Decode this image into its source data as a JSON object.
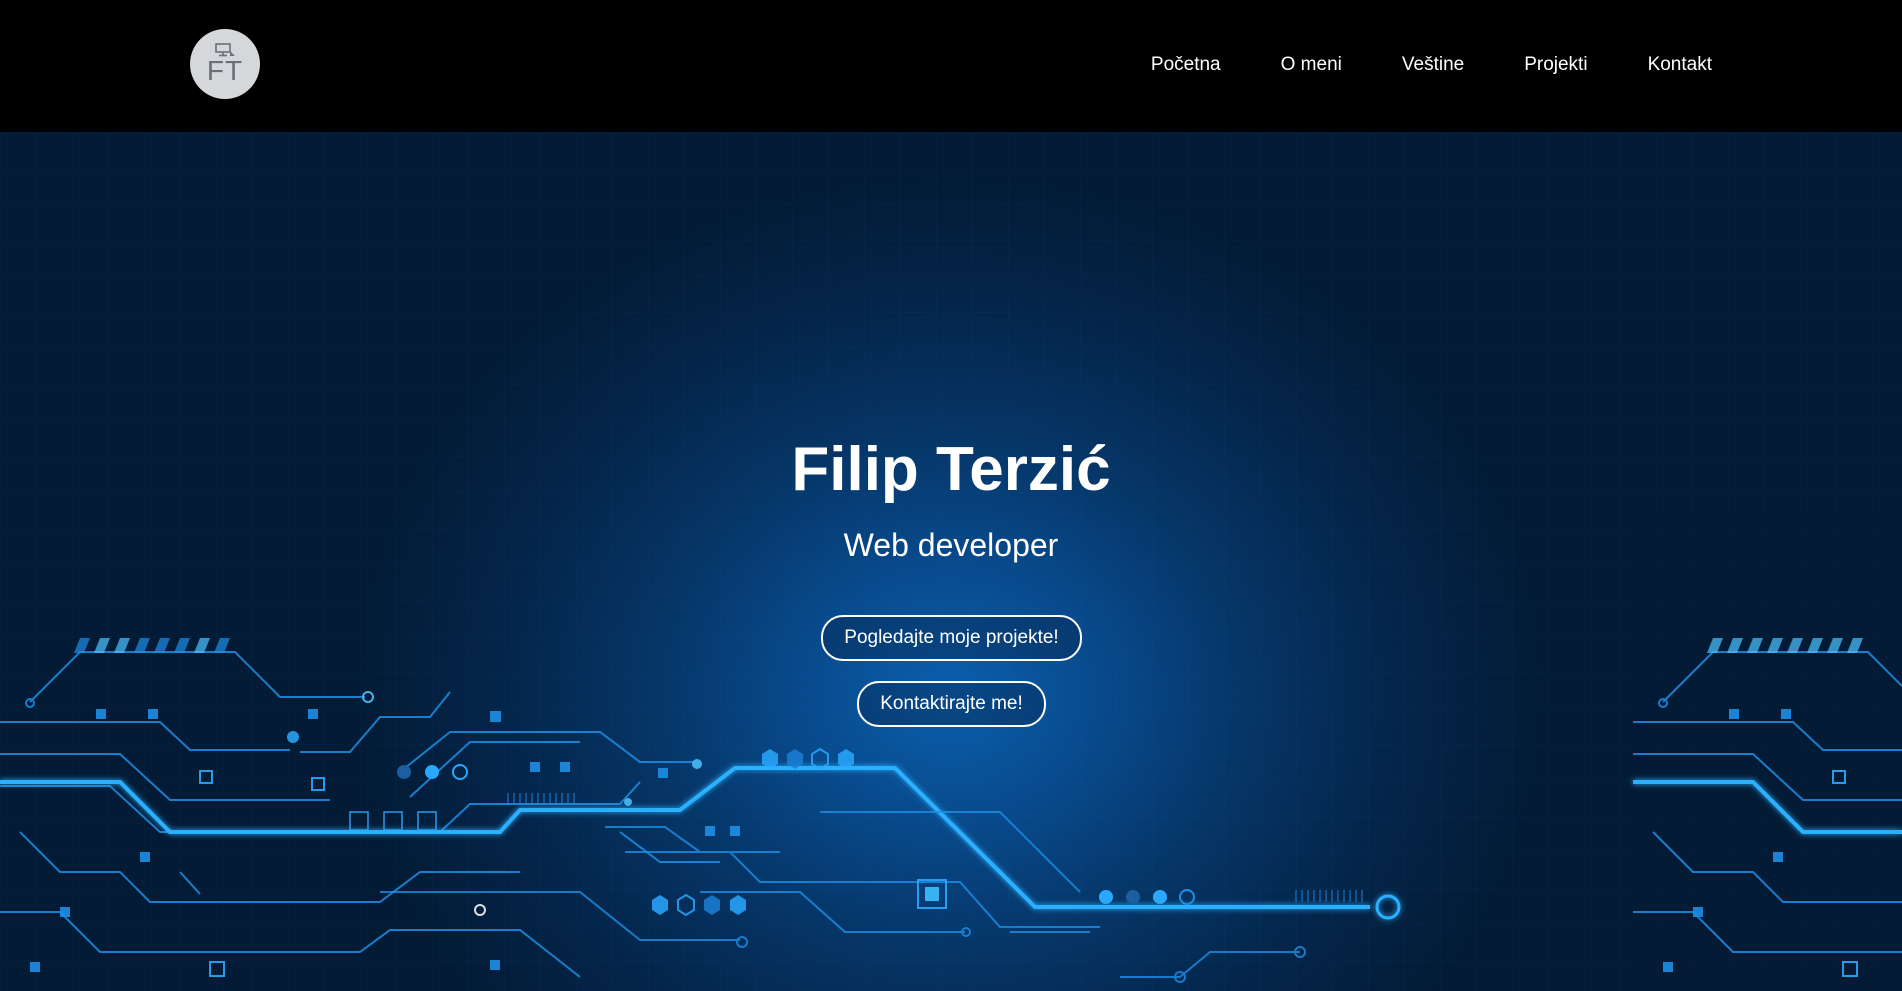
{
  "logo": {
    "text": "FT",
    "icon": "monitor-icon"
  },
  "nav": {
    "items": [
      {
        "label": "Početna"
      },
      {
        "label": "O meni"
      },
      {
        "label": "Veštine"
      },
      {
        "label": "Projekti"
      },
      {
        "label": "Kontakt"
      }
    ]
  },
  "hero": {
    "title": "Filip Terzić",
    "subtitle": "Web developer",
    "primary_button": "Pogledajte moje projekte!",
    "secondary_button": "Kontaktirajte me!"
  },
  "colors": {
    "nav_background": "#000000",
    "hero_background": "#031b35",
    "hero_glow": "#0b5fae",
    "circuit_accent": "#1ea7ff",
    "text": "#ffffff",
    "logo_background": "#d6d7db"
  }
}
